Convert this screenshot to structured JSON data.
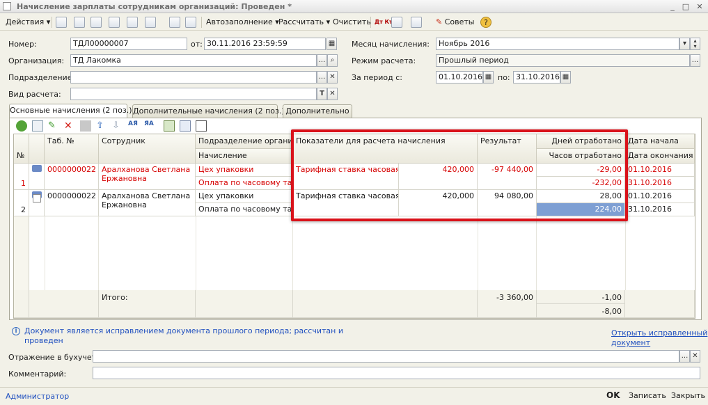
{
  "window": {
    "title": "Начисление зарплаты сотрудникам организаций: Проведен *",
    "minimize": "_",
    "maximize": "□",
    "close": "✕"
  },
  "toolbar": {
    "actions_label": "Действия",
    "autofill_label": "Автозаполнение",
    "calc_label": "Рассчитать",
    "clear_label": "Очистить",
    "dt_kt_label": "Дт Кт",
    "tips_label": "Советы",
    "help_label": "?"
  },
  "form": {
    "number_label": "Номер:",
    "number_value": "ТДЛ00000007",
    "date_label": "от:",
    "date_value": "30.11.2016 23:59:59",
    "org_label": "Организация:",
    "org_value": "ТД Лакомка",
    "dept_label": "Подразделение:",
    "dept_value": "",
    "calc_kind_label": "Вид расчета:",
    "calc_kind_value": "",
    "month_label": "Месяц начисления:",
    "month_value": "Ноябрь 2016",
    "mode_label": "Режим расчета:",
    "mode_value": "Прошлый период",
    "period_label": "За период с:",
    "period_from": "01.10.2016",
    "period_to_label": "по:",
    "period_to": "31.10.2016"
  },
  "tabs": [
    {
      "label": "Основные начисления (2 поз.)"
    },
    {
      "label": "Дополнительные начисления (2 поз.)"
    },
    {
      "label": "Дополнительно"
    }
  ],
  "grid": {
    "headers": {
      "num": "№",
      "tab": "Таб. №",
      "employee": "Сотрудник",
      "dept": "Подразделение органи...",
      "accrual": "Начисление",
      "indicators": "Показатели для расчета начисления",
      "result": "Результат",
      "days": "Дней отработано",
      "hours": "Часов отработано",
      "start": "Дата начала",
      "end": "Дата окончания"
    },
    "rows": [
      {
        "num": "1",
        "tab": "0000000022",
        "employee": "Аралханова Светлана Ержановна",
        "dept": "Цех упаковки",
        "accrual": "Оплата по часовому та...",
        "indicator": "Тарифная ставка часовая",
        "rate": "420,000",
        "result": "-97 440,00",
        "days": "-29,00",
        "hours": "-232,00",
        "start": "01.10.2016",
        "end": "31.10.2016"
      },
      {
        "num": "2",
        "tab": "0000000022",
        "employee": "Аралханова Светлана Ержановна",
        "dept": "Цех упаковки",
        "accrual": "Оплата по часовому та...",
        "indicator": "Тарифная ставка часовая",
        "rate": "420,000",
        "result": "94 080,00",
        "days": "28,00",
        "hours": "224,00",
        "start": "01.10.2016",
        "end": "31.10.2016"
      }
    ],
    "totals": {
      "label": "Итого:",
      "result": "-3 360,00",
      "days": "-1,00",
      "hours": "-8,00"
    }
  },
  "notice": {
    "text_line1": "Документ является исправлением документа прошлого периода; рассчитан и",
    "text_line2": "проведен",
    "link_line1": "Открыть исправленный",
    "link_line2": "документ"
  },
  "bottom": {
    "reflect_label": "Отражение в бухучете:",
    "reflect_value": "",
    "comment_label": "Комментарий:",
    "comment_value": ""
  },
  "footer": {
    "user": "Администратор",
    "ok": "OK",
    "save": "Записать",
    "close": "Закрыть"
  }
}
